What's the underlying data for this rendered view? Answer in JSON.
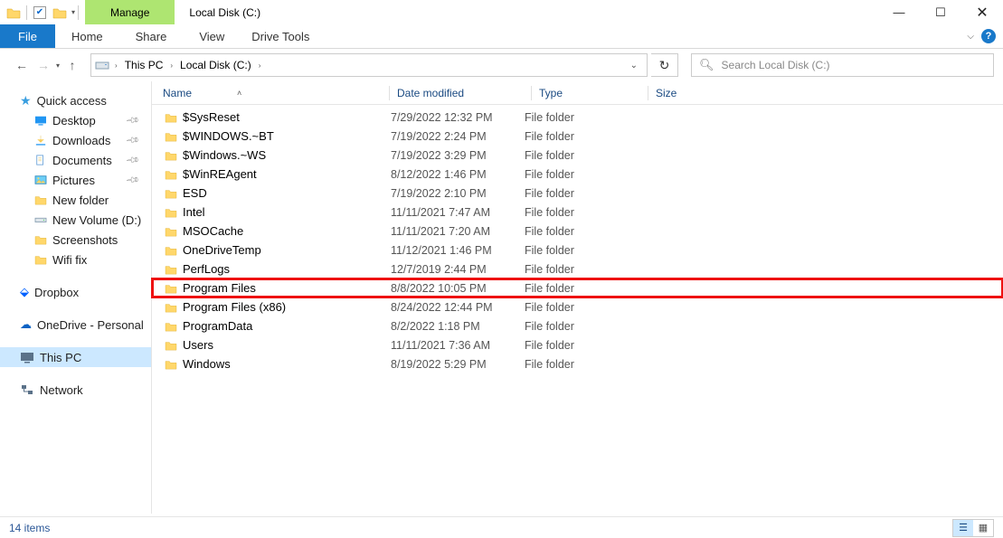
{
  "window": {
    "title": "Local Disk (C:)"
  },
  "contextual_tab": {
    "group": "Manage",
    "tab": "Drive Tools"
  },
  "ribbon": {
    "file": "File",
    "tabs": [
      "Home",
      "Share",
      "View"
    ]
  },
  "breadcrumb": {
    "root": "This PC",
    "segments": [
      "Local Disk (C:)"
    ]
  },
  "search": {
    "placeholder": "Search Local Disk (C:)"
  },
  "sidebar": {
    "quick_access": "Quick access",
    "quick_items": [
      {
        "label": "Desktop",
        "pinned": true,
        "icon": "desktop"
      },
      {
        "label": "Downloads",
        "pinned": true,
        "icon": "download"
      },
      {
        "label": "Documents",
        "pinned": true,
        "icon": "document"
      },
      {
        "label": "Pictures",
        "pinned": true,
        "icon": "picture"
      },
      {
        "label": "New folder",
        "pinned": false,
        "icon": "folder"
      },
      {
        "label": "New Volume (D:)",
        "pinned": false,
        "icon": "hdd"
      },
      {
        "label": "Screenshots",
        "pinned": false,
        "icon": "folder"
      },
      {
        "label": "Wifi fix",
        "pinned": false,
        "icon": "folder"
      }
    ],
    "dropbox": "Dropbox",
    "onedrive": "OneDrive - Personal",
    "this_pc": "This PC",
    "network": "Network"
  },
  "columns": {
    "name": "Name",
    "date": "Date modified",
    "type": "Type",
    "size": "Size"
  },
  "files": [
    {
      "name": "$SysReset",
      "date": "7/29/2022 12:32 PM",
      "type": "File folder"
    },
    {
      "name": "$WINDOWS.~BT",
      "date": "7/19/2022 2:24 PM",
      "type": "File folder"
    },
    {
      "name": "$Windows.~WS",
      "date": "7/19/2022 3:29 PM",
      "type": "File folder"
    },
    {
      "name": "$WinREAgent",
      "date": "8/12/2022 1:46 PM",
      "type": "File folder"
    },
    {
      "name": "ESD",
      "date": "7/19/2022 2:10 PM",
      "type": "File folder"
    },
    {
      "name": "Intel",
      "date": "11/11/2021 7:47 AM",
      "type": "File folder"
    },
    {
      "name": "MSOCache",
      "date": "11/11/2021 7:20 AM",
      "type": "File folder"
    },
    {
      "name": "OneDriveTemp",
      "date": "11/12/2021 1:46 PM",
      "type": "File folder"
    },
    {
      "name": "PerfLogs",
      "date": "12/7/2019 2:44 PM",
      "type": "File folder"
    },
    {
      "name": "Program Files",
      "date": "8/8/2022 10:05 PM",
      "type": "File folder",
      "highlight": true
    },
    {
      "name": "Program Files (x86)",
      "date": "8/24/2022 12:44 PM",
      "type": "File folder"
    },
    {
      "name": "ProgramData",
      "date": "8/2/2022 1:18 PM",
      "type": "File folder"
    },
    {
      "name": "Users",
      "date": "11/11/2021 7:36 AM",
      "type": "File folder"
    },
    {
      "name": "Windows",
      "date": "8/19/2022 5:29 PM",
      "type": "File folder"
    }
  ],
  "status": {
    "count": "14 items"
  }
}
